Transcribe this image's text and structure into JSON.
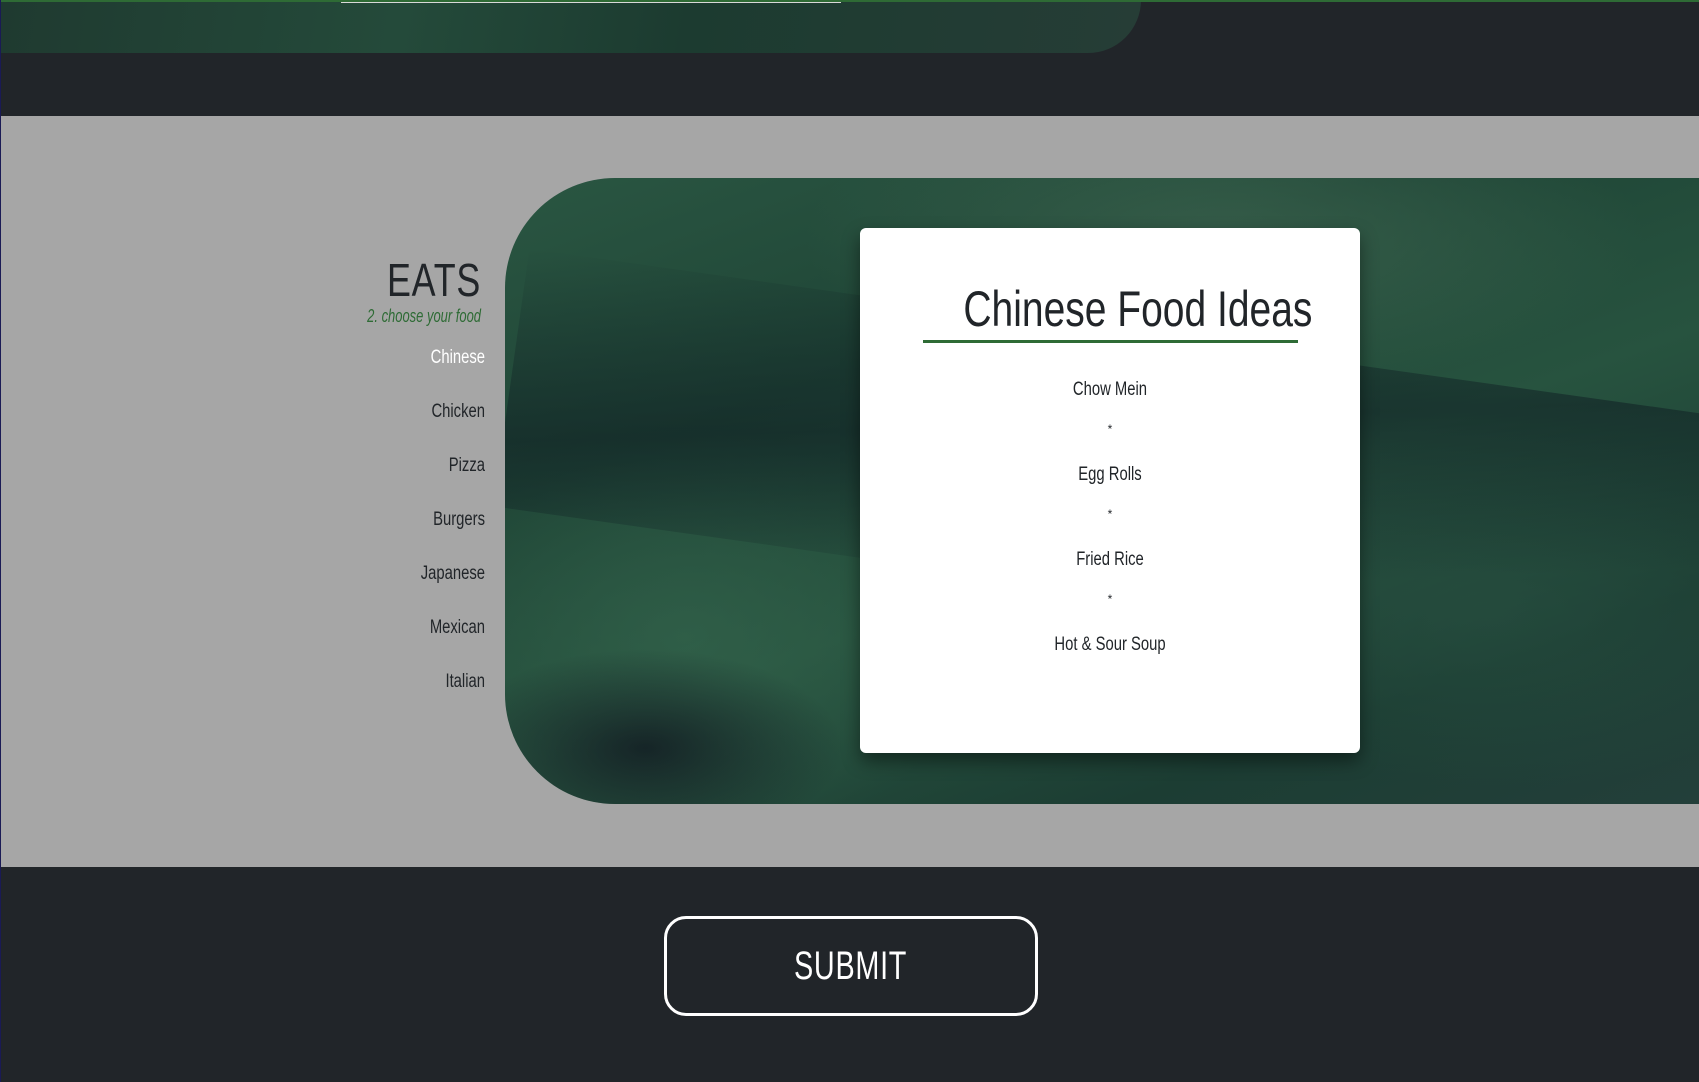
{
  "brand": {
    "title": "EATS",
    "subtitle": "2. choose your food"
  },
  "nav": {
    "items": [
      {
        "label": "Chinese",
        "active": true
      },
      {
        "label": "Chicken",
        "active": false
      },
      {
        "label": "Pizza",
        "active": false
      },
      {
        "label": "Burgers",
        "active": false
      },
      {
        "label": "Japanese",
        "active": false
      },
      {
        "label": "Mexican",
        "active": false
      },
      {
        "label": "Italian",
        "active": false
      }
    ]
  },
  "card": {
    "title": "Chinese Food Ideas",
    "separator": "*",
    "items": [
      "Chow Mein",
      "Egg Rolls",
      "Fried Rice",
      "Hot & Sour Soup"
    ]
  },
  "submit": {
    "label": "SUBMIT"
  },
  "colors": {
    "accent": "#2e6b35",
    "dark": "#212529",
    "gray": "#a6a6a6",
    "active_nav": "#ffffff"
  }
}
